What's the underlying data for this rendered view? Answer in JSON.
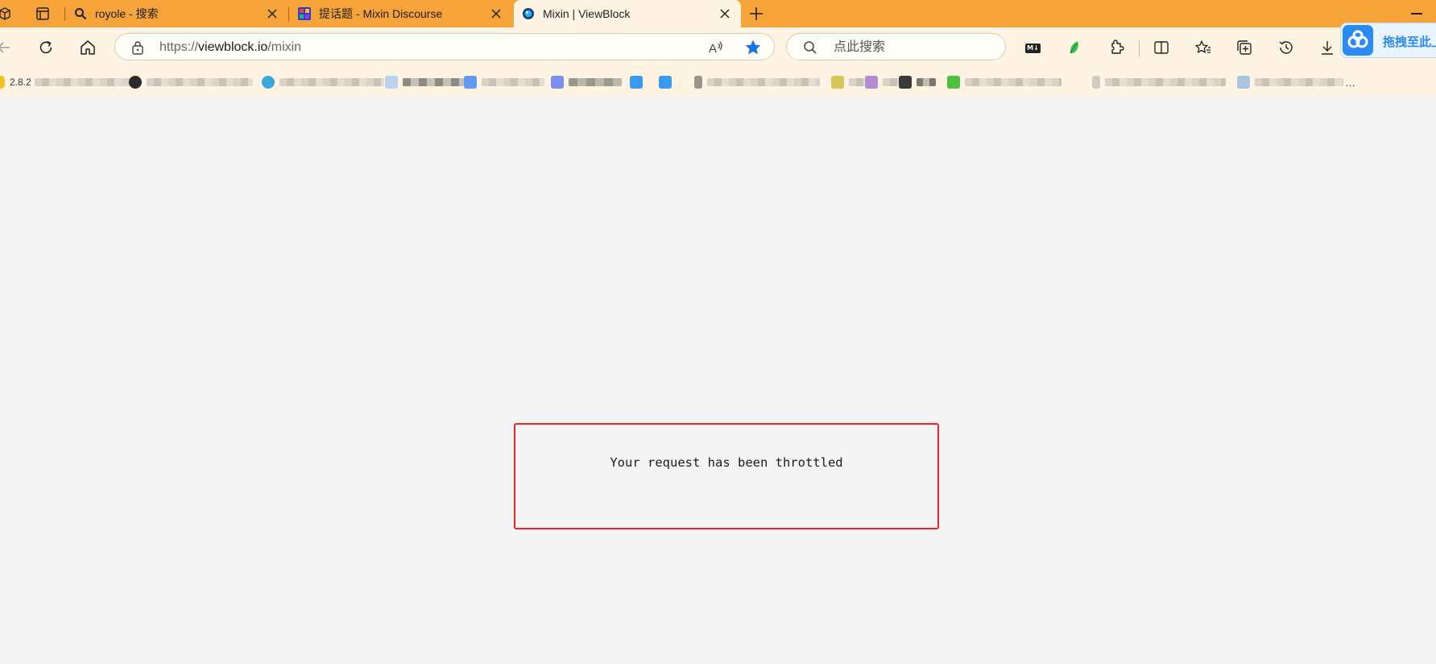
{
  "browser": {
    "tabs": [
      {
        "title": "royole - 搜索",
        "icon": "search-icon",
        "active": false
      },
      {
        "title": "提话题 - Mixin Discourse",
        "icon": "mixin-discourse-favicon",
        "active": false
      },
      {
        "title": "Mixin | ViewBlock",
        "icon": "viewblock-favicon",
        "active": true
      }
    ],
    "address_bar": {
      "url_scheme": "https://",
      "url_host": "viewblock.io",
      "url_path": "/mixin"
    },
    "search_box": {
      "placeholder": "点此搜索"
    },
    "extensions": {
      "markdown_badge": "M↓",
      "baidu_netdisk_label": "拖拽至此上"
    },
    "bookmarks": {
      "first_label": "2.8.2",
      "overflow": "…"
    }
  },
  "page": {
    "message": "Your request has been throttled"
  },
  "colors": {
    "tab_strip": "#f6a33a",
    "toolbar": "#fff4e4",
    "page_background": "#f4f4f4",
    "highlight_border": "#ee2323",
    "favorite_star": "#1a73e8"
  }
}
